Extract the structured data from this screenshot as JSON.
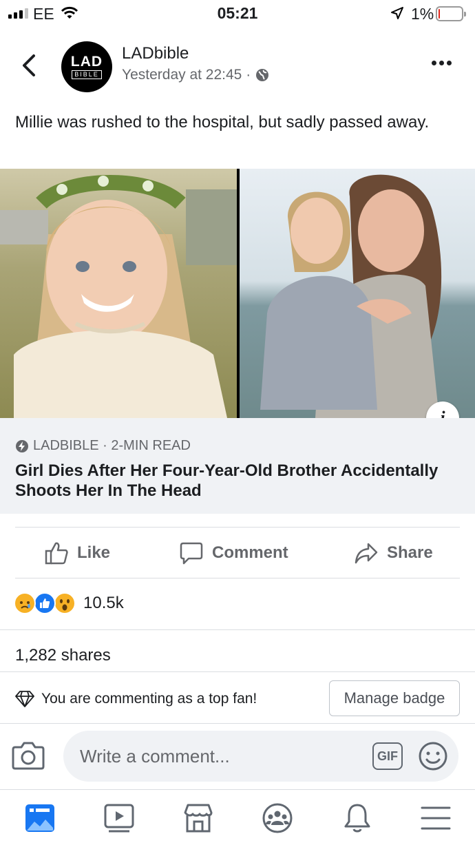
{
  "status_bar": {
    "carrier": "EE",
    "time": "05:21",
    "battery_percent": "1%",
    "battery_level": 0.05
  },
  "post": {
    "page_name": "LADbible",
    "logo_text_top": "LAD",
    "logo_text_bottom": "BIBLE",
    "timestamp": "Yesterday at 22:45 ·",
    "caption": "Millie was rushed to the hospital, but sadly passed away."
  },
  "link_preview": {
    "source": "LADBIBLE · 2-MIN READ",
    "title": "Girl Dies After Her Four-Year-Old Brother Accidentally Shoots Her In The Head",
    "info_label": "i"
  },
  "actions": {
    "like": "Like",
    "comment": "Comment",
    "share": "Share"
  },
  "engagement": {
    "reaction_count": "10.5k",
    "shares": "1,282 shares",
    "reaction_icons": [
      "sad-reaction-icon",
      "like-reaction-icon",
      "wow-reaction-icon"
    ]
  },
  "comment_area": {
    "top_fan_text": "You are commenting as a top fan!",
    "manage_badge": "Manage badge",
    "placeholder": "Write a comment...",
    "gif_label": "GIF"
  },
  "tabbar": [
    "news-feed-icon",
    "watch-icon",
    "marketplace-icon",
    "groups-icon",
    "notifications-icon",
    "menu-icon"
  ],
  "colors": {
    "accent": "#1877f2",
    "secondary_text": "#65676b",
    "link_box_bg": "#f0f2f5"
  }
}
